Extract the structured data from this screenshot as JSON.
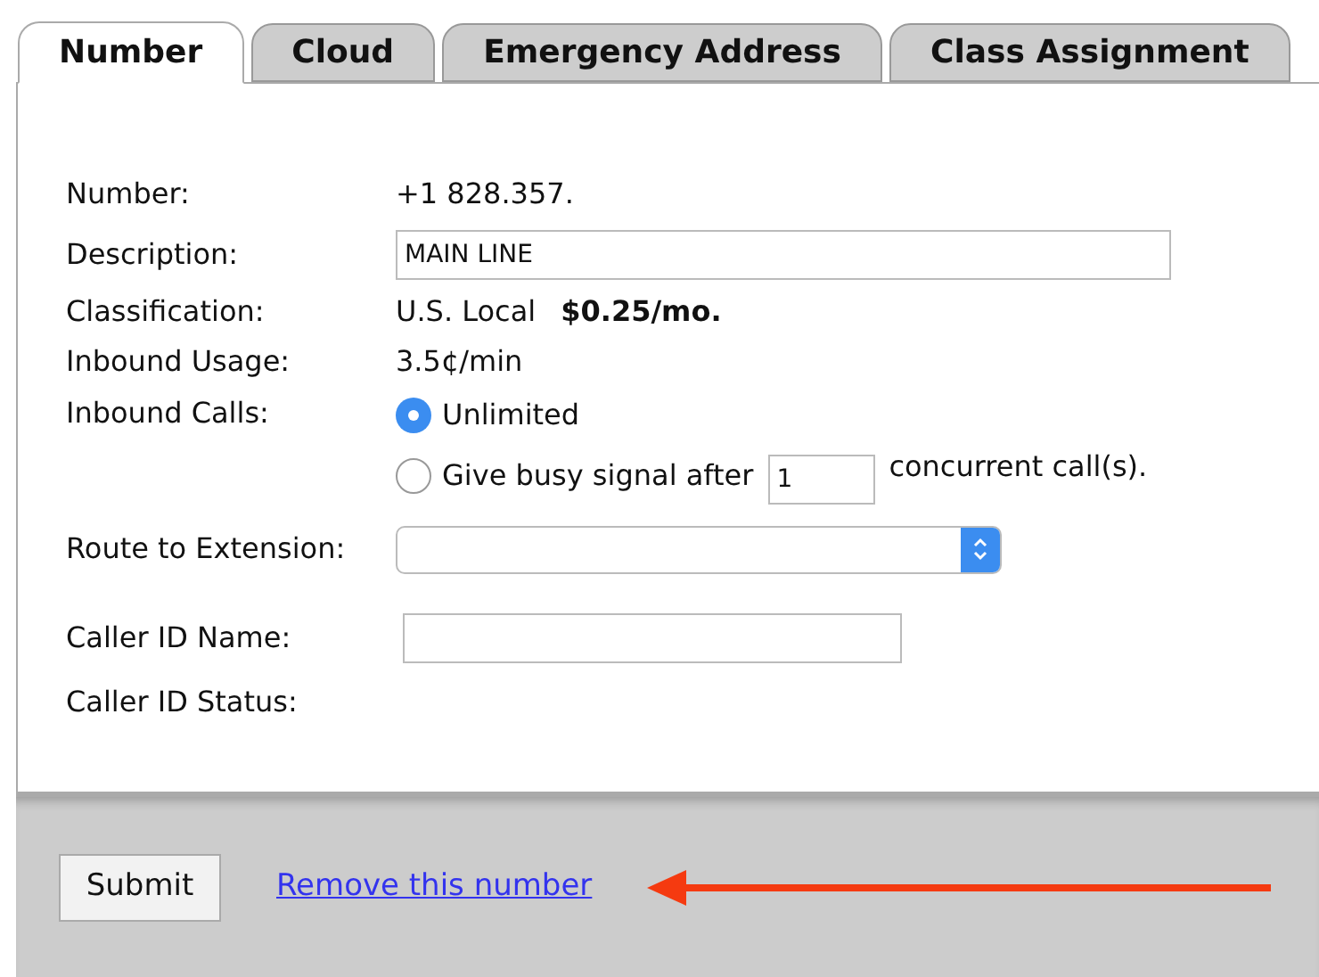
{
  "tabs": [
    {
      "label": "Number",
      "selected": true
    },
    {
      "label": "Cloud",
      "selected": false
    },
    {
      "label": "Emergency Address",
      "selected": false
    },
    {
      "label": "Class Assignment",
      "selected": false
    }
  ],
  "form": {
    "number": {
      "label": "Number:",
      "value": "+1 828.357."
    },
    "description": {
      "label": "Description:",
      "value": "MAIN LINE"
    },
    "classification": {
      "label": "Classification:",
      "value": "U.S. Local",
      "price": "$0.25/mo."
    },
    "inbound_usage": {
      "label": "Inbound Usage:",
      "value": "3.5¢/min"
    },
    "inbound_calls": {
      "label": "Inbound Calls:",
      "options": [
        {
          "label": "Unlimited",
          "selected": true
        },
        {
          "label": "Give busy signal after",
          "selected": false,
          "count": "1",
          "suffix": "concurrent call(s)."
        }
      ]
    },
    "route_to_extension": {
      "label": "Route to Extension:"
    },
    "caller_id_name": {
      "label": "Caller ID Name:"
    },
    "caller_id_status": {
      "label": "Caller ID Status:"
    }
  },
  "footer": {
    "submit": "Submit",
    "remove_link": "Remove this number"
  }
}
